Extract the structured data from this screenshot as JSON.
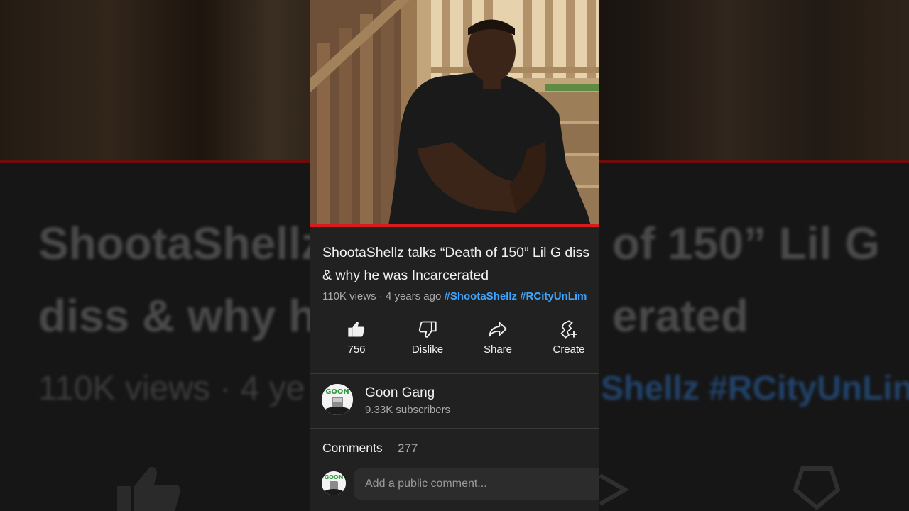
{
  "video": {
    "title": "ShootaShellz talks “Death of 150”  Lil G diss & why he was Incarcerated",
    "views": "110K views",
    "separator": " · ",
    "age": "4 years ago",
    "hashtags": [
      "#ShootaShellz",
      "#RCityUnLim"
    ],
    "progress": 1.0
  },
  "backdrop": {
    "title_line1": "ShootaShellz",
    "title_line1_right": "of 150”  Lil G",
    "title_line2": "diss & why h",
    "title_line2_right": "erated",
    "meta_left": "110K views · 4 ye",
    "meta_right": "Shellz #RCityUnLin"
  },
  "actions": [
    {
      "label": "756",
      "icon": "thumbs-up-icon"
    },
    {
      "label": "Dislike",
      "icon": "thumbs-down-icon"
    },
    {
      "label": "Share",
      "icon": "share-icon"
    },
    {
      "label": "Create",
      "icon": "create-icon"
    }
  ],
  "channel": {
    "name": "Goon Gang",
    "subscribers": "9.33K subscribers",
    "avatar_text": "GOON"
  },
  "comments": {
    "label": "Comments",
    "count": "277",
    "placeholder": "Add a public comment..."
  },
  "colors": {
    "accent_red": "#d81b1b",
    "hashtag_blue": "#3ea6ff",
    "surface": "#212121"
  }
}
